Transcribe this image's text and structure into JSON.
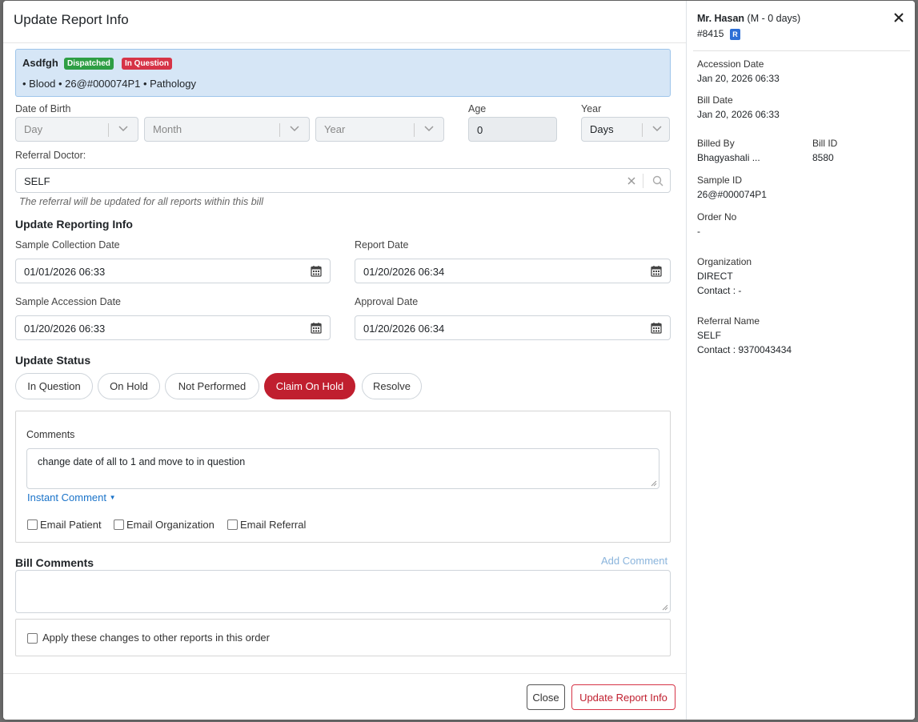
{
  "modal": {
    "title": "Update Report Info"
  },
  "report": {
    "name": "Asdfgh",
    "badges": [
      {
        "label": "Dispatched",
        "color": "#2e9e44"
      },
      {
        "label": "In Question",
        "color": "#d63447"
      }
    ],
    "details": "• Blood • 26@#000074P1 • Pathology"
  },
  "dob": {
    "label": "Date of Birth",
    "day_placeholder": "Day",
    "month_placeholder": "Month",
    "year_placeholder": "Year",
    "age_label": "Age",
    "age_value": "0",
    "unit_label": "Year",
    "unit_value": "Days"
  },
  "referral": {
    "label": "Referral Doctor:",
    "value": "SELF",
    "hint": "The referral will be updated for all reports within this bill"
  },
  "reporting": {
    "title": "Update Reporting Info",
    "sample_collection_label": "Sample Collection Date",
    "sample_collection_value": "01/01/2026 06:33",
    "report_date_label": "Report Date",
    "report_date_value": "01/20/2026 06:34",
    "sample_accession_label": "Sample Accession Date",
    "sample_accession_value": "01/20/2026 06:33",
    "approval_date_label": "Approval Date",
    "approval_date_value": "01/20/2026 06:34"
  },
  "status": {
    "title": "Update Status",
    "options": [
      "In Question",
      "On Hold",
      "Not Performed",
      "Claim On Hold",
      "Resolve"
    ],
    "selected": "Claim On Hold"
  },
  "comments": {
    "label": "Comments",
    "value": "change date of all to 1 and move to in question",
    "instant_comment": "Instant Comment",
    "email_patient": "Email Patient",
    "email_organization": "Email Organization",
    "email_referral": "Email Referral"
  },
  "bill_comments": {
    "title": "Bill Comments",
    "add_comment": "Add Comment",
    "value": ""
  },
  "apply_all": {
    "label": "Apply these changes to other reports in this order"
  },
  "footer": {
    "close": "Close",
    "update": "Update Report Info"
  },
  "patient": {
    "name": "Mr. Hasan",
    "meta": "(M - 0 days)",
    "id": "#8415",
    "tag": "R",
    "accession_date_label": "Accession Date",
    "accession_date": "Jan 20, 2026 06:33",
    "bill_date_label": "Bill Date",
    "bill_date": "Jan 20, 2026 06:33",
    "billed_by_label": "Billed By",
    "billed_by": "Bhagyashali ...",
    "bill_id_label": "Bill ID",
    "bill_id": "8580",
    "sample_id_label": "Sample ID",
    "sample_id": "26@#000074P1",
    "order_no_label": "Order No",
    "order_no": "-",
    "organization_label": "Organization",
    "organization": "DIRECT",
    "organization_contact": "Contact : -",
    "referral_name_label": "Referral Name",
    "referral_name": "SELF",
    "referral_contact": "Contact : 9370043434"
  },
  "colors": {
    "accent_blue": "#0d6efd",
    "danger": "#c01f2f",
    "link": "#1a73c9"
  }
}
